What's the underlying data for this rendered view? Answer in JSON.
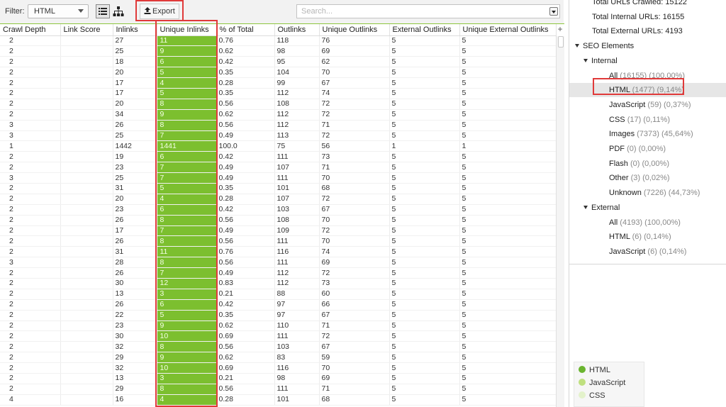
{
  "toolbar": {
    "filter_label": "Filter:",
    "filter_value": "HTML",
    "export_label": "Export",
    "search_placeholder": "Search..."
  },
  "table": {
    "columns": [
      "Crawl Depth",
      "Link Score",
      "Inlinks",
      "Unique Inlinks",
      "% of Total",
      "Outlinks",
      "Unique Outlinks",
      "External Outlinks",
      "Unique External Outlinks"
    ],
    "add_column_symbol": "+",
    "rows": [
      [
        "2",
        "",
        "27",
        "11",
        "0.76",
        "118",
        "76",
        "5",
        "5"
      ],
      [
        "2",
        "",
        "25",
        "9",
        "0.62",
        "98",
        "69",
        "5",
        "5"
      ],
      [
        "2",
        "",
        "18",
        "6",
        "0.42",
        "95",
        "62",
        "5",
        "5"
      ],
      [
        "2",
        "",
        "20",
        "5",
        "0.35",
        "104",
        "70",
        "5",
        "5"
      ],
      [
        "2",
        "",
        "17",
        "4",
        "0.28",
        "99",
        "67",
        "5",
        "5"
      ],
      [
        "2",
        "",
        "17",
        "5",
        "0.35",
        "112",
        "74",
        "5",
        "5"
      ],
      [
        "2",
        "",
        "20",
        "8",
        "0.56",
        "108",
        "72",
        "5",
        "5"
      ],
      [
        "2",
        "",
        "34",
        "9",
        "0.62",
        "112",
        "72",
        "5",
        "5"
      ],
      [
        "3",
        "",
        "26",
        "8",
        "0.56",
        "112",
        "71",
        "5",
        "5"
      ],
      [
        "3",
        "",
        "25",
        "7",
        "0.49",
        "113",
        "72",
        "5",
        "5"
      ],
      [
        "1",
        "",
        "1442",
        "1441",
        "100.0",
        "75",
        "56",
        "1",
        "1"
      ],
      [
        "2",
        "",
        "19",
        "6",
        "0.42",
        "111",
        "73",
        "5",
        "5"
      ],
      [
        "2",
        "",
        "23",
        "7",
        "0.49",
        "107",
        "71",
        "5",
        "5"
      ],
      [
        "3",
        "",
        "25",
        "7",
        "0.49",
        "111",
        "70",
        "5",
        "5"
      ],
      [
        "2",
        "",
        "31",
        "5",
        "0.35",
        "101",
        "68",
        "5",
        "5"
      ],
      [
        "2",
        "",
        "20",
        "4",
        "0.28",
        "107",
        "72",
        "5",
        "5"
      ],
      [
        "2",
        "",
        "23",
        "6",
        "0.42",
        "103",
        "67",
        "5",
        "5"
      ],
      [
        "2",
        "",
        "26",
        "8",
        "0.56",
        "108",
        "70",
        "5",
        "5"
      ],
      [
        "2",
        "",
        "17",
        "7",
        "0.49",
        "109",
        "72",
        "5",
        "5"
      ],
      [
        "2",
        "",
        "26",
        "8",
        "0.56",
        "111",
        "70",
        "5",
        "5"
      ],
      [
        "2",
        "",
        "31",
        "11",
        "0.76",
        "116",
        "74",
        "5",
        "5"
      ],
      [
        "3",
        "",
        "28",
        "8",
        "0.56",
        "111",
        "69",
        "5",
        "5"
      ],
      [
        "2",
        "",
        "26",
        "7",
        "0.49",
        "112",
        "72",
        "5",
        "5"
      ],
      [
        "2",
        "",
        "30",
        "12",
        "0.83",
        "112",
        "73",
        "5",
        "5"
      ],
      [
        "2",
        "",
        "13",
        "3",
        "0.21",
        "88",
        "60",
        "5",
        "5"
      ],
      [
        "2",
        "",
        "26",
        "6",
        "0.42",
        "97",
        "66",
        "5",
        "5"
      ],
      [
        "2",
        "",
        "22",
        "5",
        "0.35",
        "97",
        "67",
        "5",
        "5"
      ],
      [
        "2",
        "",
        "23",
        "9",
        "0.62",
        "110",
        "71",
        "5",
        "5"
      ],
      [
        "2",
        "",
        "30",
        "10",
        "0.69",
        "111",
        "72",
        "5",
        "5"
      ],
      [
        "2",
        "",
        "32",
        "8",
        "0.56",
        "103",
        "67",
        "5",
        "5"
      ],
      [
        "2",
        "",
        "29",
        "9",
        "0.62",
        "83",
        "59",
        "5",
        "5"
      ],
      [
        "2",
        "",
        "32",
        "10",
        "0.69",
        "116",
        "70",
        "5",
        "5"
      ],
      [
        "2",
        "",
        "13",
        "3",
        "0.21",
        "98",
        "69",
        "5",
        "5"
      ],
      [
        "2",
        "",
        "29",
        "8",
        "0.56",
        "111",
        "71",
        "5",
        "5"
      ],
      [
        "4",
        "",
        "16",
        "4",
        "0.28",
        "101",
        "68",
        "5",
        "5"
      ]
    ]
  },
  "tree": {
    "items": [
      {
        "label": "Total URLs Crawled: 15122",
        "extra": "",
        "indent": 1,
        "arrow": false,
        "selected": false
      },
      {
        "label": "Total Internal URLs: 16155",
        "extra": "",
        "indent": 1,
        "arrow": false,
        "selected": false
      },
      {
        "label": "Total External URLs: 4193",
        "extra": "",
        "indent": 1,
        "arrow": false,
        "selected": false
      },
      {
        "label": "SEO Elements",
        "extra": "",
        "indent": 0,
        "arrow": true,
        "selected": false
      },
      {
        "label": "Internal",
        "extra": "",
        "indent": 1,
        "arrow": true,
        "selected": false
      },
      {
        "label": "All",
        "extra": "(16155) (100,00%)",
        "indent": 2,
        "arrow": false,
        "selected": false
      },
      {
        "label": "HTML",
        "extra": "(1477) (9,14%)",
        "indent": 2,
        "arrow": false,
        "selected": true
      },
      {
        "label": "JavaScript",
        "extra": "(59) (0,37%)",
        "indent": 2,
        "arrow": false,
        "selected": false
      },
      {
        "label": "CSS",
        "extra": "(17) (0,11%)",
        "indent": 2,
        "arrow": false,
        "selected": false
      },
      {
        "label": "Images",
        "extra": "(7373) (45,64%)",
        "indent": 2,
        "arrow": false,
        "selected": false
      },
      {
        "label": "PDF",
        "extra": "(0) (0,00%)",
        "indent": 2,
        "arrow": false,
        "selected": false
      },
      {
        "label": "Flash",
        "extra": "(0) (0,00%)",
        "indent": 2,
        "arrow": false,
        "selected": false
      },
      {
        "label": "Other",
        "extra": "(3) (0,02%)",
        "indent": 2,
        "arrow": false,
        "selected": false
      },
      {
        "label": "Unknown",
        "extra": "(7226) (44,73%)",
        "indent": 2,
        "arrow": false,
        "selected": false
      },
      {
        "label": "External",
        "extra": "",
        "indent": 1,
        "arrow": true,
        "selected": false
      },
      {
        "label": "All",
        "extra": "(4193) (100,00%)",
        "indent": 2,
        "arrow": false,
        "selected": false
      },
      {
        "label": "HTML",
        "extra": "(6) (0,14%)",
        "indent": 2,
        "arrow": false,
        "selected": false
      },
      {
        "label": "JavaScript",
        "extra": "(6) (0,14%)",
        "indent": 2,
        "arrow": false,
        "selected": false
      }
    ]
  },
  "legend": {
    "items": [
      {
        "label": "HTML",
        "color": "#6ab42f"
      },
      {
        "label": "JavaScript",
        "color": "#bfe07f"
      },
      {
        "label": "CSS",
        "color": "#e3f2cb"
      }
    ]
  },
  "colors": {
    "accent_green": "#7cbf2f",
    "highlight_red": "#e03a3a"
  }
}
